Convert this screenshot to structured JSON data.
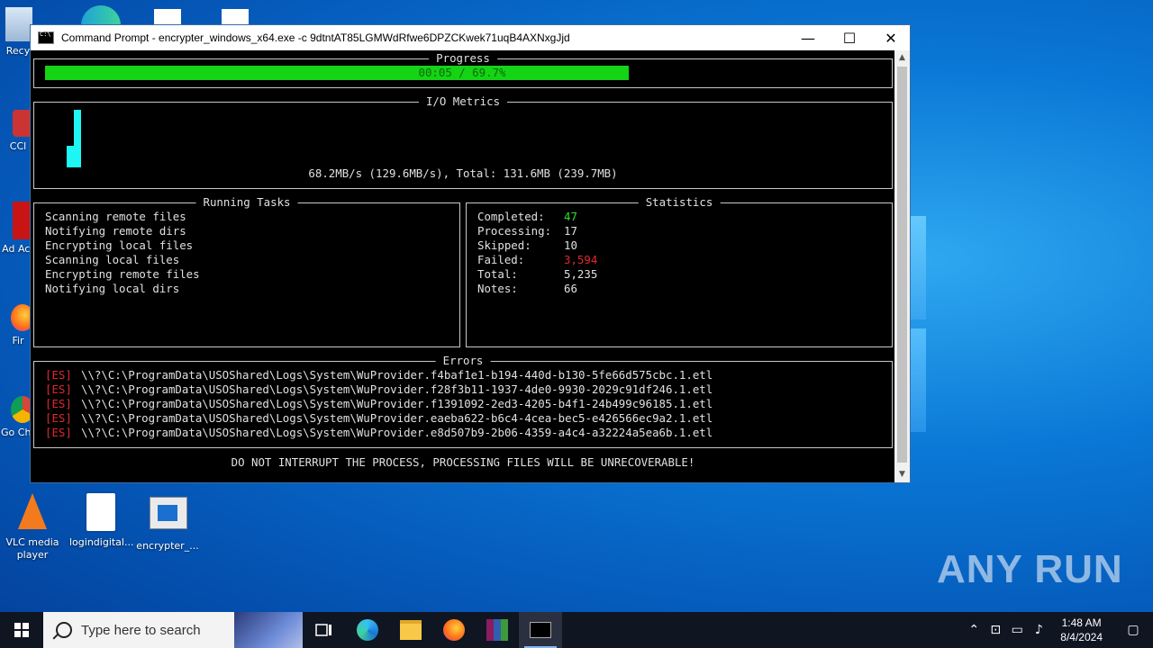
{
  "desktop": {
    "icons": [
      {
        "label": "Recy"
      },
      {
        "label": "CCl"
      },
      {
        "label": "Ad Acr"
      },
      {
        "label": "Fir"
      },
      {
        "label": "Go Chr"
      },
      {
        "label": "VLC media player"
      },
      {
        "label": "logindigital..."
      },
      {
        "label": "encrypter_..."
      }
    ],
    "watermark": "ANY RUN"
  },
  "window": {
    "title": "Command Prompt - encrypter_windows_x64.exe  -c 9dtntAT85LGMWdRfwe6DPZCKwek71uqB4AXNxgJjd",
    "controls": {
      "minimize": "—",
      "maximize": "☐",
      "close": "✕"
    }
  },
  "console": {
    "progress": {
      "label": "Progress",
      "text": "00:05 / 69.7%",
      "fraction": 0.697
    },
    "io": {
      "label": "I/O Metrics",
      "summary": "68.2MB/s (129.6MB/s), Total: 131.6MB (239.7MB)"
    },
    "tasks": {
      "label": "Running Tasks",
      "items": [
        "Scanning remote files",
        "Notifying remote dirs",
        "Encrypting local files",
        "Scanning local files",
        "Encrypting remote files",
        "Notifying local dirs"
      ]
    },
    "stats": {
      "label": "Statistics",
      "rows": [
        {
          "key": "Completed:",
          "value": "47"
        },
        {
          "key": "Processing:",
          "value": "17"
        },
        {
          "key": "Skipped:",
          "value": "10"
        },
        {
          "key": "Failed:",
          "value": "3,594"
        },
        {
          "key": "Total:",
          "value": "5,235"
        },
        {
          "key": "Notes:",
          "value": "66"
        }
      ],
      "colors": {
        "completed": "#2ee02e",
        "failed": "#e02a2a"
      }
    },
    "errors": {
      "label": "Errors",
      "tag": "[ES]",
      "lines": [
        "\\\\?\\C:\\ProgramData\\USOShared\\Logs\\System\\WuProvider.f4baf1e1-b194-440d-b130-5fe66d575cbc.1.etl",
        "\\\\?\\C:\\ProgramData\\USOShared\\Logs\\System\\WuProvider.f28f3b11-1937-4de0-9930-2029c91df246.1.etl",
        "\\\\?\\C:\\ProgramData\\USOShared\\Logs\\System\\WuProvider.f1391092-2ed3-4205-b4f1-24b499c96185.1.etl",
        "\\\\?\\C:\\ProgramData\\USOShared\\Logs\\System\\WuProvider.eaeba622-b6c4-4cea-bec5-e426566ec9a2.1.etl",
        "\\\\?\\C:\\ProgramData\\USOShared\\Logs\\System\\WuProvider.e8d507b9-2b06-4359-a4c4-a32224a5ea6b.1.etl"
      ]
    },
    "warning": "DO NOT INTERRUPT THE PROCESS, PROCESSING FILES WILL BE UNRECOVERABLE!"
  },
  "taskbar": {
    "search_placeholder": "Type here to search",
    "clock": {
      "time": "1:48 AM",
      "date": "8/4/2024"
    }
  }
}
